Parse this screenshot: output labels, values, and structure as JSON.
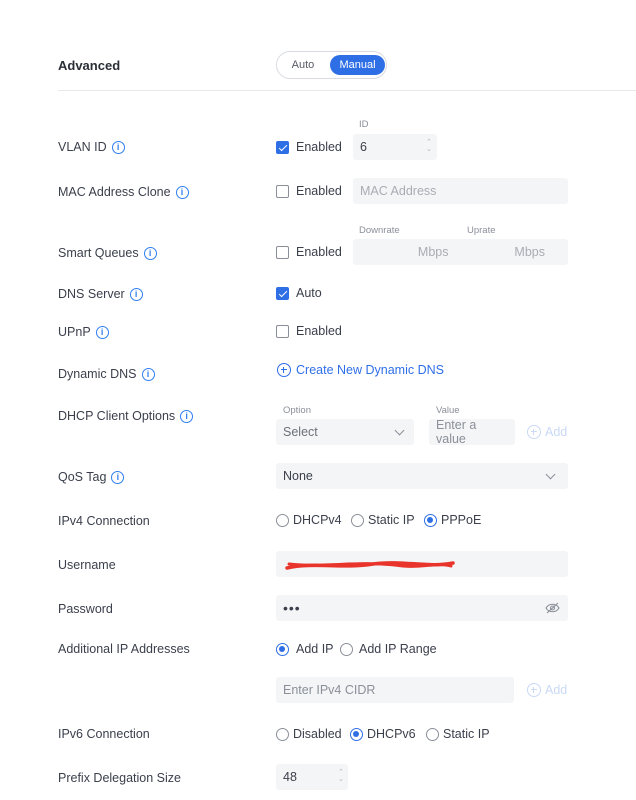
{
  "section": {
    "title": "Advanced"
  },
  "mode_toggle": {
    "auto": "Auto",
    "manual": "Manual",
    "selected": "Manual"
  },
  "vlan": {
    "label": "VLAN ID",
    "enabled": true,
    "enabled_label": "Enabled",
    "id_caption": "ID",
    "id_value": "6"
  },
  "mac_clone": {
    "label": "MAC Address Clone",
    "enabled": false,
    "enabled_label": "Enabled",
    "placeholder": "MAC Address"
  },
  "smart_queues": {
    "label": "Smart Queues",
    "enabled": false,
    "enabled_label": "Enabled",
    "downrate_caption": "Downrate",
    "uprate_caption": "Uprate",
    "downrate_unit": "Mbps",
    "uprate_unit": "Mbps"
  },
  "dns_server": {
    "label": "DNS Server",
    "auto": true,
    "auto_label": "Auto"
  },
  "upnp": {
    "label": "UPnP",
    "enabled": false,
    "enabled_label": "Enabled"
  },
  "dynamic_dns": {
    "label": "Dynamic DNS",
    "create_label": "Create New Dynamic DNS"
  },
  "dhcp_client": {
    "label": "DHCP Client Options",
    "option_caption": "Option",
    "value_caption": "Value",
    "option_value": "Select",
    "value_placeholder": "Enter a value",
    "add_label": "Add"
  },
  "qos": {
    "label": "QoS Tag",
    "value": "None"
  },
  "ipv4": {
    "label": "IPv4 Connection",
    "options": [
      "DHCPv4",
      "Static IP",
      "PPPoE"
    ],
    "selected": "PPPoE"
  },
  "username": {
    "label": "Username",
    "value": "redacted"
  },
  "password": {
    "label": "Password",
    "value": "•••"
  },
  "additional_ip": {
    "label": "Additional IP Addresses",
    "options": [
      "Add IP",
      "Add IP Range"
    ],
    "selected": "Add IP",
    "placeholder": "Enter IPv4 CIDR",
    "add_label": "Add"
  },
  "ipv6": {
    "label": "IPv6 Connection",
    "options": [
      "Disabled",
      "DHCPv6",
      "Static IP"
    ],
    "selected": "DHCPv6"
  },
  "prefix": {
    "label": "Prefix Delegation Size",
    "value": "48"
  },
  "colors": {
    "accent": "#2f6fe6",
    "redaction": "#e8342a"
  }
}
